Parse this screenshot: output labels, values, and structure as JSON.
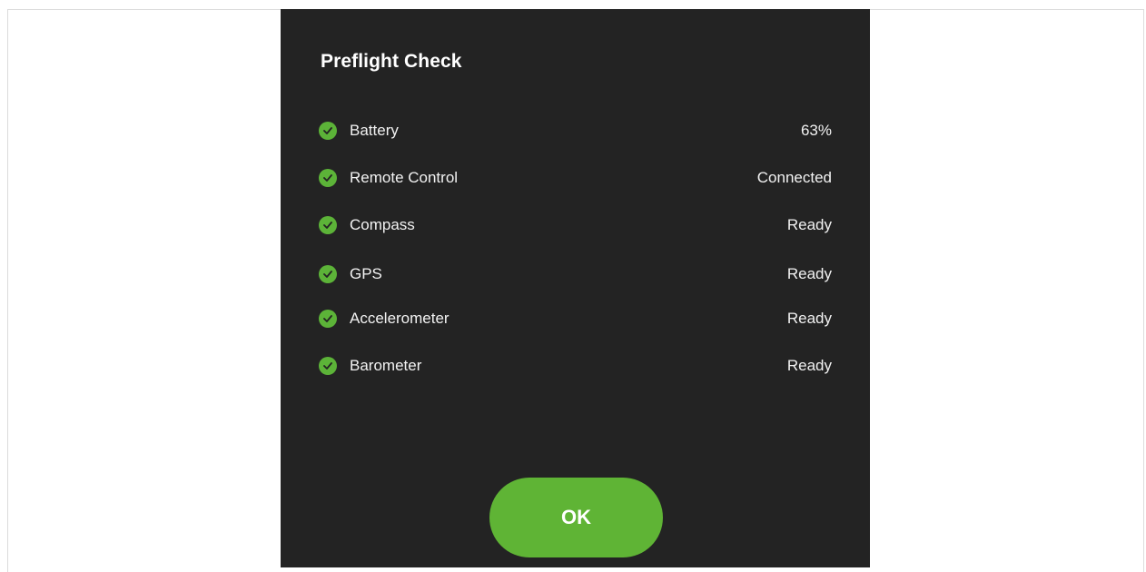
{
  "dialog": {
    "title": "Preflight Check",
    "items": [
      {
        "label": "Battery",
        "value": "63%",
        "status": "ok"
      },
      {
        "label": "Remote Control",
        "value": "Connected",
        "status": "ok"
      },
      {
        "label": "Compass",
        "value": "Ready",
        "status": "ok"
      },
      {
        "label": "GPS",
        "value": "Ready",
        "status": "ok"
      },
      {
        "label": "Accelerometer",
        "value": "Ready",
        "status": "ok"
      },
      {
        "label": "Barometer",
        "value": "Ready",
        "status": "ok"
      }
    ],
    "ok_label": "OK"
  },
  "colors": {
    "dialog_bg": "#232323",
    "accent": "#5cb338",
    "text": "#ffffff"
  },
  "icons": {
    "status_ok": "check-circle-icon"
  }
}
